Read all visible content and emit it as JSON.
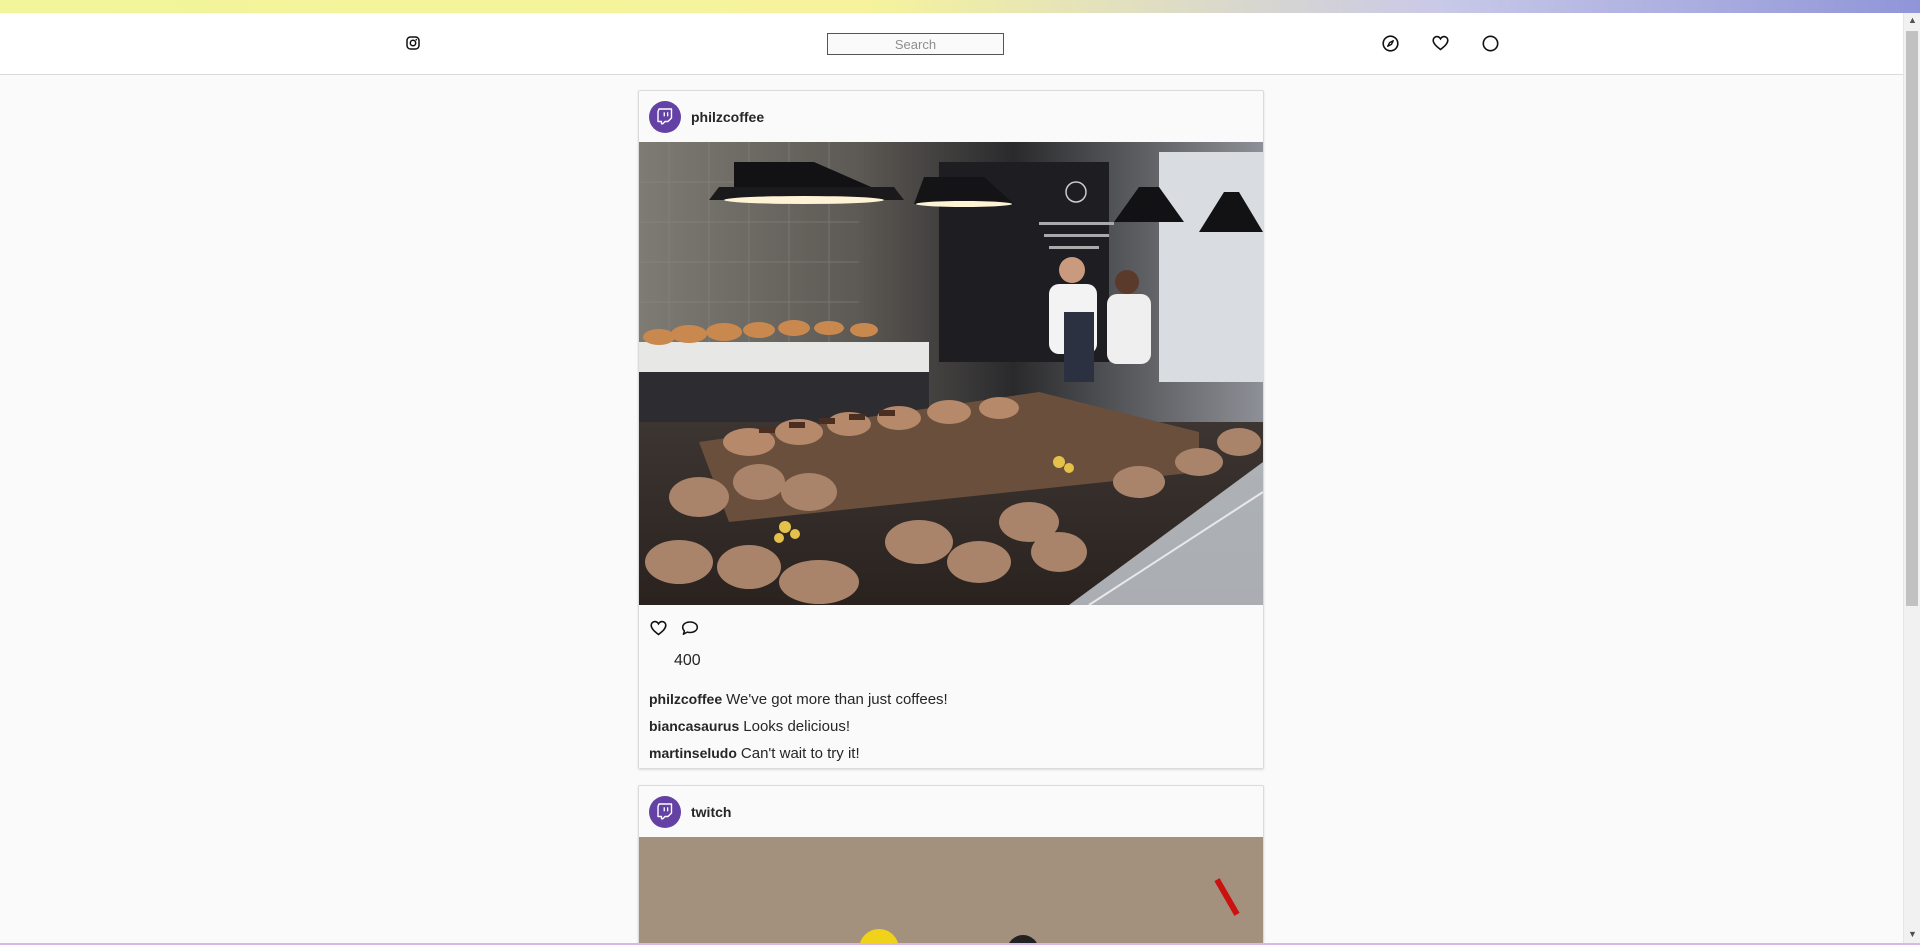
{
  "header": {
    "logo_icon": "instagram-icon",
    "search_placeholder": "Search",
    "icons": [
      "explore-compass-icon",
      "heart-icon",
      "profile-circle-icon"
    ]
  },
  "posts": [
    {
      "username": "philzcoffee",
      "avatar_icon": "twitch-icon",
      "avatar_color": "#6441a5",
      "image_description_icon": "bakery-photo",
      "likes": "400",
      "comments": [
        {
          "user": "philzcoffee",
          "text": "We've got more than just coffees!"
        },
        {
          "user": "biancasaurus",
          "text": "Looks delicious!"
        },
        {
          "user": "martinseludo",
          "text": "Can't wait to try it!"
        }
      ]
    },
    {
      "username": "twitch",
      "avatar_icon": "twitch-icon",
      "avatar_color": "#6441a5"
    }
  ]
}
